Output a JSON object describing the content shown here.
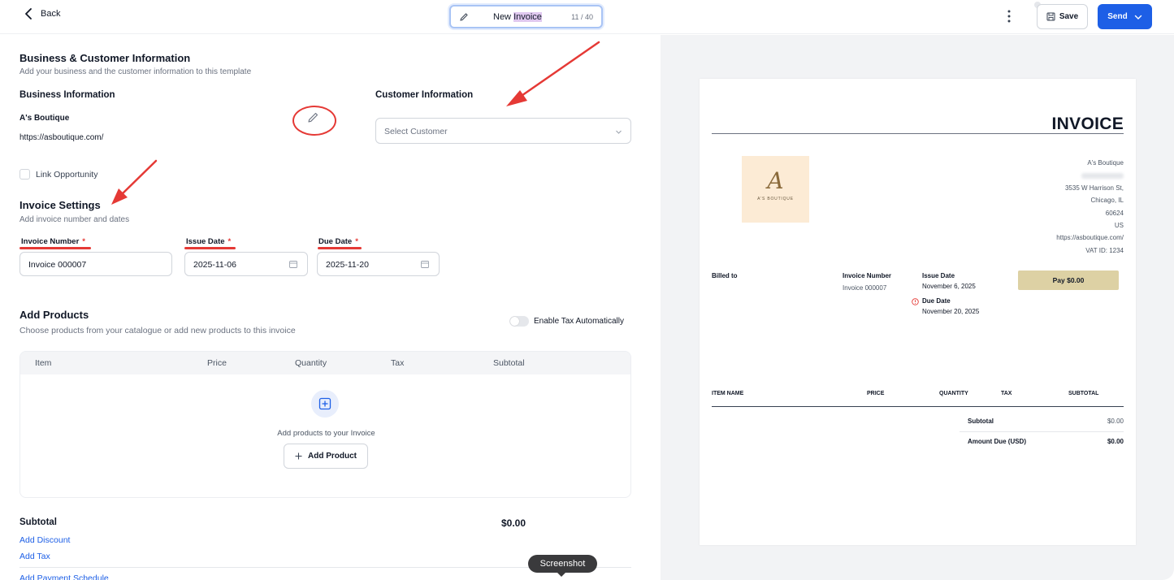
{
  "topbar": {
    "back_label": "Back",
    "title_prefix": "New ",
    "title_highlight": "Invoice",
    "char_count": "11 / 40",
    "save_label": "Save",
    "send_label": "Send"
  },
  "business_customer": {
    "title": "Business & Customer Information",
    "subtitle": "Add your business and the customer information to this template",
    "business_heading": "Business Information",
    "business_name": "A's Boutique",
    "business_url": "https://asboutique.com/",
    "customer_heading": "Customer Information",
    "customer_placeholder": "Select Customer",
    "link_opportunity_label": "Link Opportunity"
  },
  "invoice_settings": {
    "title": "Invoice Settings",
    "subtitle": "Add invoice number and dates",
    "invoice_number_label": "Invoice Number",
    "invoice_number_value": "Invoice 000007",
    "issue_date_label": "Issue Date",
    "issue_date_value": "2025-11-06",
    "due_date_label": "Due Date",
    "due_date_value": "2025-11-20",
    "required_mark": "*"
  },
  "products": {
    "title": "Add Products",
    "subtitle": "Choose products from your catalogue or add new products to this invoice",
    "tax_toggle_label": "Enable Tax Automatically",
    "tax_toggle_on": false,
    "columns": [
      "Item",
      "Price",
      "Quantity",
      "Tax",
      "Subtotal"
    ],
    "empty_message": "Add products to your Invoice",
    "add_product_label": "Add Product"
  },
  "totals": {
    "subtotal_label": "Subtotal",
    "subtotal_value": "$0.00",
    "add_discount": "Add Discount",
    "add_tax": "Add Tax",
    "add_payment_schedule": "Add Payment Schedule"
  },
  "tooltip": "Screenshot",
  "preview": {
    "title": "INVOICE",
    "logo_monogram": "A",
    "logo_brand": "A'S BOUTIQUE",
    "business_lines": [
      "A's Boutique",
      "3535 W Harrison St,",
      "Chicago, IL",
      "60624",
      "US",
      "https://asboutique.com/",
      "VAT ID: 1234"
    ],
    "billed_to_label": "Billed to",
    "invoice_number_label": "Invoice Number",
    "invoice_number_value": "Invoice 000007",
    "issue_date_label": "Issue Date",
    "issue_date_value": "November 6, 2025",
    "due_date_label": "Due Date",
    "due_date_value": "November 20, 2025",
    "pay_button": "Pay $0.00",
    "columns": [
      "ITEM NAME",
      "PRICE",
      "QUANTITY",
      "TAX",
      "SUBTOTAL"
    ],
    "subtotal_label": "Subtotal",
    "subtotal_value": "$0.00",
    "amount_due_label": "Amount Due (USD)",
    "amount_due_value": "$0.00"
  },
  "colors": {
    "primary": "#1d5fe6",
    "annotation_red": "#e53935",
    "pay_button": "#ddd1a4",
    "logo_bg": "#fcebd5"
  }
}
